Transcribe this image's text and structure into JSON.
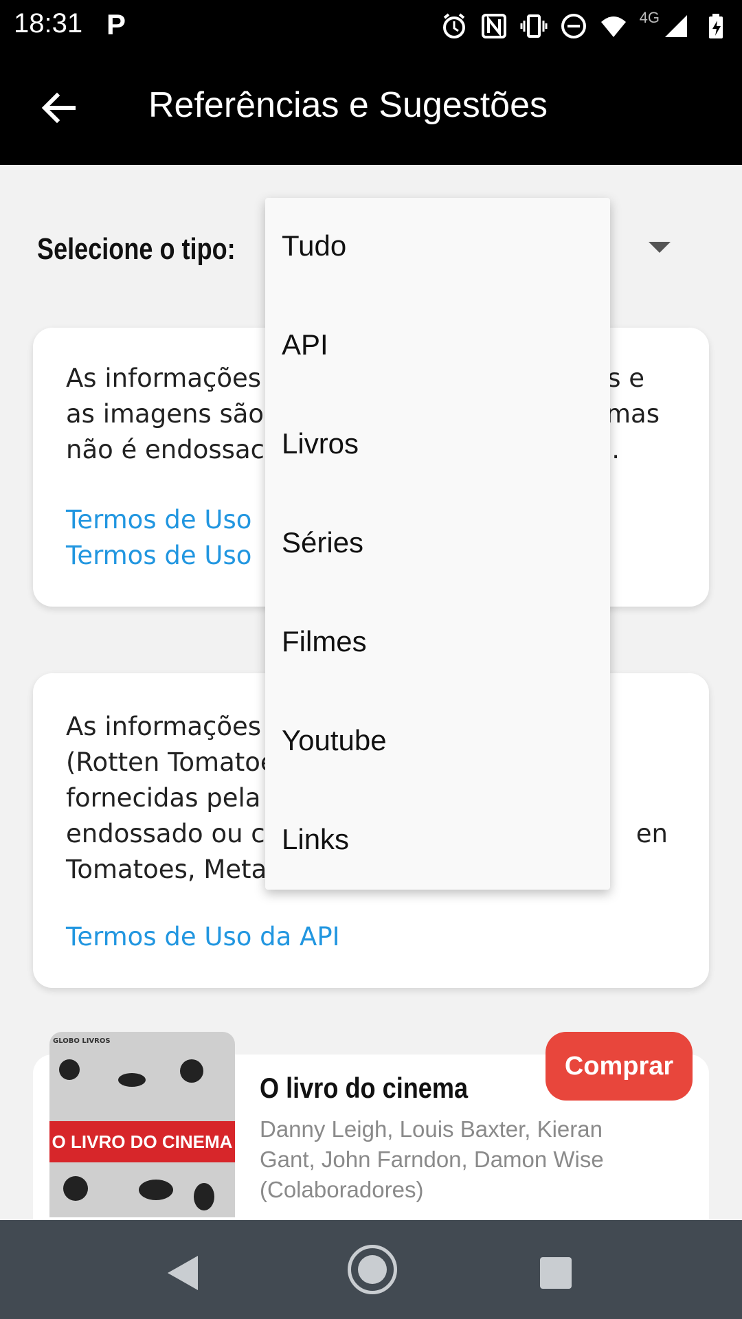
{
  "status_bar": {
    "time": "18:31",
    "network": "4G"
  },
  "app_bar": {
    "title": "Referências e Sugestões"
  },
  "filter": {
    "label": "Selecione o tipo:"
  },
  "menu": {
    "items": [
      "Tudo",
      "API",
      "Livros",
      "Séries",
      "Filmes",
      "Youtube",
      "Links"
    ]
  },
  "cards": [
    {
      "lines": [
        "As informações",
        "as imagens são",
        "não é endossac"
      ],
      "lines_right": [
        "s e",
        "mas",
        "."
      ],
      "links": [
        "Termos de Uso",
        "Termos de Uso"
      ]
    },
    {
      "lines": [
        "As informações",
        "(Rotten Tomatoe",
        "fornecidas pela",
        "endossado ou c",
        "Tomatoes, Meta"
      ],
      "lines_right": [
        "en"
      ],
      "link": "Termos de Uso da API"
    }
  ],
  "book": {
    "title": "O livro do cinema",
    "authors": "Danny Leigh, Louis Baxter, Kieran Gant, John Farndon, Damon Wise (Colaboradores)",
    "buy_label": "Comprar",
    "cover_text": "O LIVRO DO CINEMA",
    "cover_publisher": "GLOBO LIVROS"
  },
  "colors": {
    "link": "#2196e0",
    "buy_button": "#e8463c",
    "app_bar": "#000000",
    "nav_bar": "#424a52"
  }
}
